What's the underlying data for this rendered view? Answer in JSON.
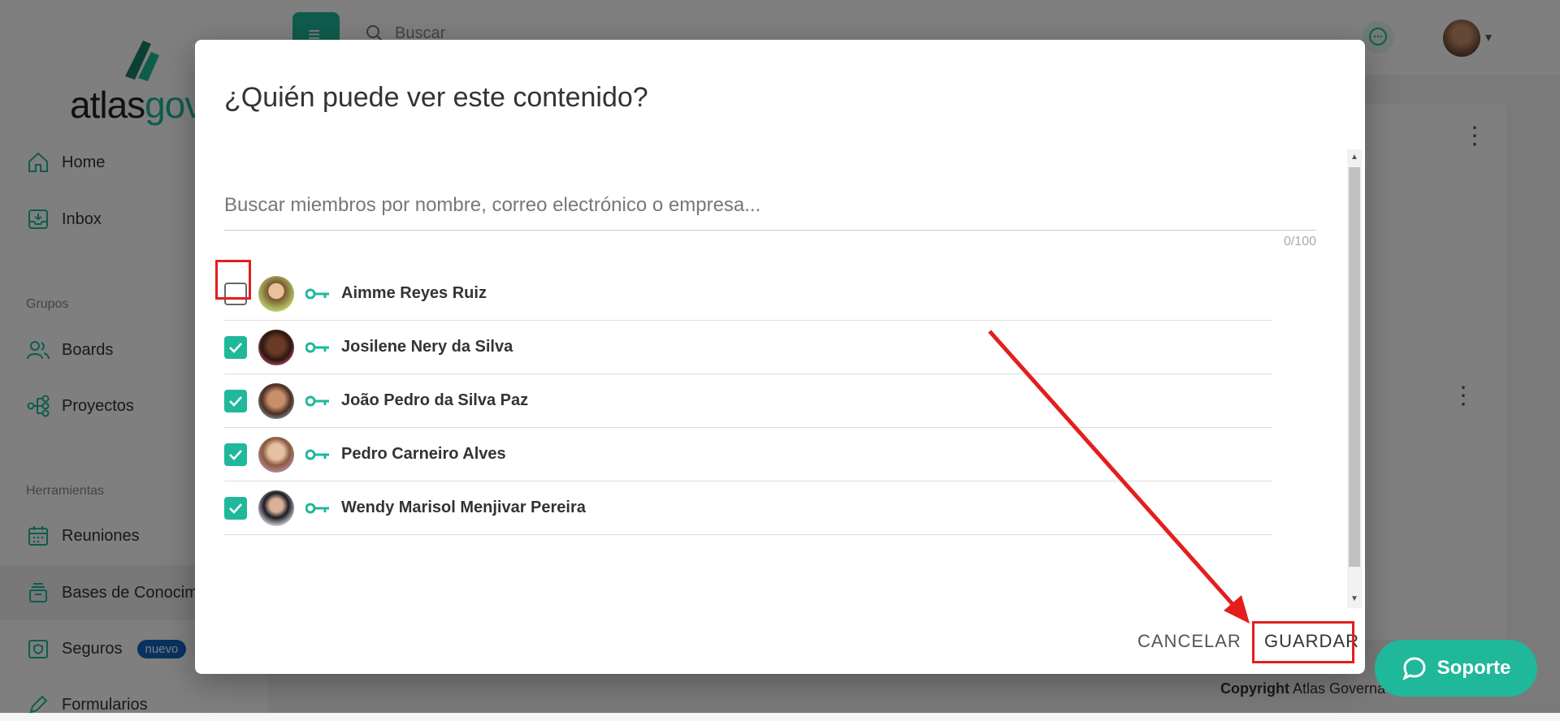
{
  "app": {
    "logo_text_main": "atlas",
    "logo_text_accent": "gov",
    "search_placeholder": "Buscar",
    "nav": {
      "home": "Home",
      "inbox": "Inbox",
      "section_groups": "Grupos",
      "boards": "Boards",
      "projects": "Proyectos",
      "section_tools": "Herramientas",
      "meetings": "Reuniones",
      "knowledge": "Bases de Conocim",
      "insurance": "Seguros",
      "insurance_badge": "nuevo",
      "forms": "Formularios"
    },
    "copyright_label": "Copyright",
    "copyright_owner": "Atlas Governa",
    "support_label": "Soporte"
  },
  "modal": {
    "title": "¿Quién puede ver este contenido?",
    "search_placeholder": "Buscar miembros por nombre, correo electrónico o empresa...",
    "counter": "0/100",
    "members": [
      {
        "name": "Aimme Reyes Ruiz",
        "checked": false
      },
      {
        "name": "Josilene Nery da Silva",
        "checked": true
      },
      {
        "name": "João Pedro da Silva Paz",
        "checked": true
      },
      {
        "name": "Pedro Carneiro Alves",
        "checked": true
      },
      {
        "name": "Wendy Marisol Menjivar Pereira",
        "checked": true
      }
    ],
    "cancel_label": "CANCELAR",
    "save_label": "GUARDAR"
  },
  "colors": {
    "accent": "#1fb89a",
    "annotation": "#e41e1e"
  }
}
